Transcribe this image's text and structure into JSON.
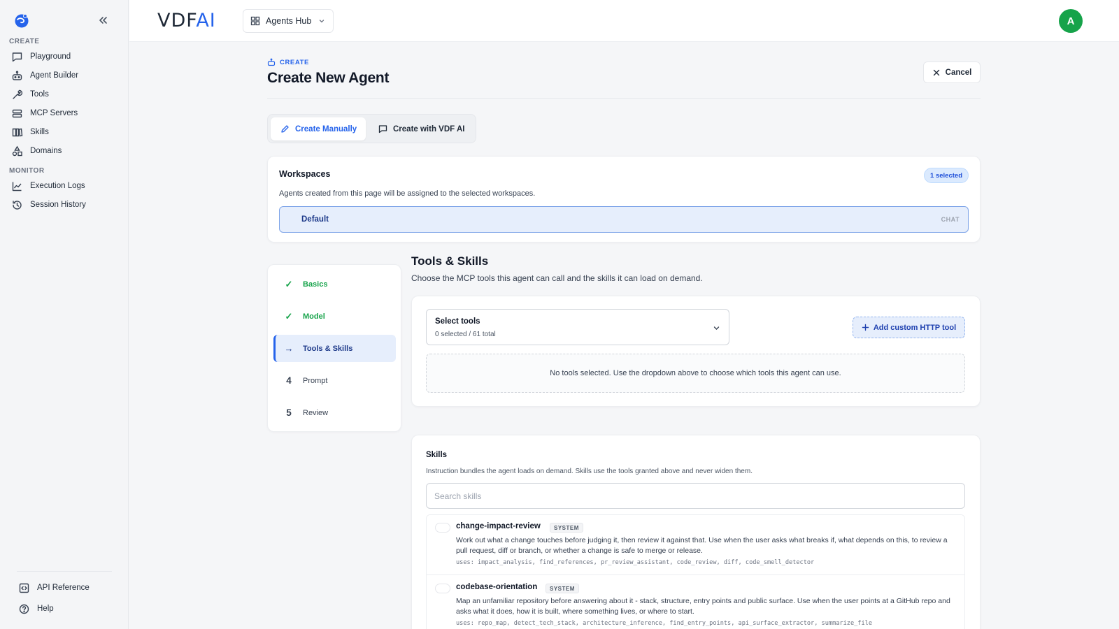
{
  "colors": {
    "accent": "#2563eb",
    "success": "#16a34a",
    "avatar": "#16a34a"
  },
  "sidebar": {
    "collapse_icon": "chevrons-left-icon",
    "sections": [
      {
        "label": "CREATE"
      },
      {
        "label": "MONITOR"
      }
    ],
    "create_items": [
      {
        "label": "Playground",
        "icon": "chat-icon"
      },
      {
        "label": "Agent Builder",
        "icon": "robot-icon"
      },
      {
        "label": "Tools",
        "icon": "wrench-icon"
      },
      {
        "label": "MCP Servers",
        "icon": "server-icon"
      },
      {
        "label": "Skills",
        "icon": "book-icon"
      },
      {
        "label": "Domains",
        "icon": "shapes-icon"
      }
    ],
    "monitor_items": [
      {
        "label": "Execution Logs",
        "icon": "chart-line-icon"
      },
      {
        "label": "Session History",
        "icon": "history-icon"
      }
    ],
    "footer_items": [
      {
        "label": "API Reference",
        "icon": "code-icon"
      },
      {
        "label": "Help",
        "icon": "help-icon"
      }
    ]
  },
  "topbar": {
    "brand_main": "VDF",
    "brand_accent": "AI",
    "hub_label": "Agents Hub",
    "avatar_initial": "A"
  },
  "header": {
    "eyebrow": "CREATE",
    "title": "Create New Agent",
    "cancel_label": "Cancel"
  },
  "mode": {
    "manual_label": "Create Manually",
    "ai_label": "Create with VDF AI"
  },
  "workspaces": {
    "title": "Workspaces",
    "badge": "1 selected",
    "description": "Agents created from this page will be assigned to the selected workspaces.",
    "items": [
      {
        "name": "Default",
        "tag": "CHAT",
        "selected": true
      }
    ]
  },
  "steps": [
    {
      "label": "Basics",
      "mark": "✓",
      "state": "done"
    },
    {
      "label": "Model",
      "mark": "✓",
      "state": "done"
    },
    {
      "label": "Tools & Skills",
      "mark": "→",
      "state": "current"
    },
    {
      "label": "Prompt",
      "mark": "4",
      "state": "todo"
    },
    {
      "label": "Review",
      "mark": "5",
      "state": "todo"
    }
  ],
  "tools_section": {
    "title": "Tools & Skills",
    "subtitle": "Choose the MCP tools this agent can call and the skills it can load on demand.",
    "select_label": "Select tools",
    "select_count": "0 selected / 61 total",
    "add_http_label": "Add custom HTTP tool",
    "empty_message": "No tools selected. Use the dropdown above to choose which tools this agent can use."
  },
  "skills": {
    "title": "Skills",
    "description": "Instruction bundles the agent loads on demand. Skills use the tools granted above and never widen them.",
    "search_placeholder": "Search skills",
    "items": [
      {
        "name": "change-impact-review",
        "badge": "SYSTEM",
        "description": "Work out what a change touches before judging it, then review it against that. Use when the user asks what breaks if, what depends on this, to review a pull request, diff or branch, or whether a change is safe to merge or release.",
        "uses": "uses: impact_analysis, find_references, pr_review_assistant, code_review, diff, code_smell_detector"
      },
      {
        "name": "codebase-orientation",
        "badge": "SYSTEM",
        "description": "Map an unfamiliar repository before answering about it - stack, structure, entry points and public surface. Use when the user points at a GitHub repo and asks what it does, how it is built, where something lives, or where to start.",
        "uses": "uses: repo_map, detect_tech_stack, architecture_inference, find_entry_points, api_surface_extractor, summarize_file"
      }
    ]
  }
}
